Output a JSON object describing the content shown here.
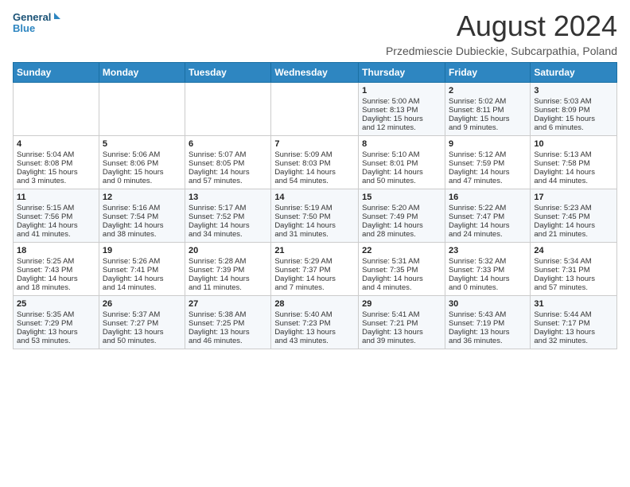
{
  "header": {
    "logo_line1": "General",
    "logo_line2": "Blue",
    "month_title": "August 2024",
    "location": "Przedmiescie Dubieckie, Subcarpathia, Poland"
  },
  "days_of_week": [
    "Sunday",
    "Monday",
    "Tuesday",
    "Wednesday",
    "Thursday",
    "Friday",
    "Saturday"
  ],
  "weeks": [
    [
      {
        "day": "",
        "text": ""
      },
      {
        "day": "",
        "text": ""
      },
      {
        "day": "",
        "text": ""
      },
      {
        "day": "",
        "text": ""
      },
      {
        "day": "1",
        "text": "Sunrise: 5:00 AM\nSunset: 8:13 PM\nDaylight: 15 hours\nand 12 minutes."
      },
      {
        "day": "2",
        "text": "Sunrise: 5:02 AM\nSunset: 8:11 PM\nDaylight: 15 hours\nand 9 minutes."
      },
      {
        "day": "3",
        "text": "Sunrise: 5:03 AM\nSunset: 8:09 PM\nDaylight: 15 hours\nand 6 minutes."
      }
    ],
    [
      {
        "day": "4",
        "text": "Sunrise: 5:04 AM\nSunset: 8:08 PM\nDaylight: 15 hours\nand 3 minutes."
      },
      {
        "day": "5",
        "text": "Sunrise: 5:06 AM\nSunset: 8:06 PM\nDaylight: 15 hours\nand 0 minutes."
      },
      {
        "day": "6",
        "text": "Sunrise: 5:07 AM\nSunset: 8:05 PM\nDaylight: 14 hours\nand 57 minutes."
      },
      {
        "day": "7",
        "text": "Sunrise: 5:09 AM\nSunset: 8:03 PM\nDaylight: 14 hours\nand 54 minutes."
      },
      {
        "day": "8",
        "text": "Sunrise: 5:10 AM\nSunset: 8:01 PM\nDaylight: 14 hours\nand 50 minutes."
      },
      {
        "day": "9",
        "text": "Sunrise: 5:12 AM\nSunset: 7:59 PM\nDaylight: 14 hours\nand 47 minutes."
      },
      {
        "day": "10",
        "text": "Sunrise: 5:13 AM\nSunset: 7:58 PM\nDaylight: 14 hours\nand 44 minutes."
      }
    ],
    [
      {
        "day": "11",
        "text": "Sunrise: 5:15 AM\nSunset: 7:56 PM\nDaylight: 14 hours\nand 41 minutes."
      },
      {
        "day": "12",
        "text": "Sunrise: 5:16 AM\nSunset: 7:54 PM\nDaylight: 14 hours\nand 38 minutes."
      },
      {
        "day": "13",
        "text": "Sunrise: 5:17 AM\nSunset: 7:52 PM\nDaylight: 14 hours\nand 34 minutes."
      },
      {
        "day": "14",
        "text": "Sunrise: 5:19 AM\nSunset: 7:50 PM\nDaylight: 14 hours\nand 31 minutes."
      },
      {
        "day": "15",
        "text": "Sunrise: 5:20 AM\nSunset: 7:49 PM\nDaylight: 14 hours\nand 28 minutes."
      },
      {
        "day": "16",
        "text": "Sunrise: 5:22 AM\nSunset: 7:47 PM\nDaylight: 14 hours\nand 24 minutes."
      },
      {
        "day": "17",
        "text": "Sunrise: 5:23 AM\nSunset: 7:45 PM\nDaylight: 14 hours\nand 21 minutes."
      }
    ],
    [
      {
        "day": "18",
        "text": "Sunrise: 5:25 AM\nSunset: 7:43 PM\nDaylight: 14 hours\nand 18 minutes."
      },
      {
        "day": "19",
        "text": "Sunrise: 5:26 AM\nSunset: 7:41 PM\nDaylight: 14 hours\nand 14 minutes."
      },
      {
        "day": "20",
        "text": "Sunrise: 5:28 AM\nSunset: 7:39 PM\nDaylight: 14 hours\nand 11 minutes."
      },
      {
        "day": "21",
        "text": "Sunrise: 5:29 AM\nSunset: 7:37 PM\nDaylight: 14 hours\nand 7 minutes."
      },
      {
        "day": "22",
        "text": "Sunrise: 5:31 AM\nSunset: 7:35 PM\nDaylight: 14 hours\nand 4 minutes."
      },
      {
        "day": "23",
        "text": "Sunrise: 5:32 AM\nSunset: 7:33 PM\nDaylight: 14 hours\nand 0 minutes."
      },
      {
        "day": "24",
        "text": "Sunrise: 5:34 AM\nSunset: 7:31 PM\nDaylight: 13 hours\nand 57 minutes."
      }
    ],
    [
      {
        "day": "25",
        "text": "Sunrise: 5:35 AM\nSunset: 7:29 PM\nDaylight: 13 hours\nand 53 minutes."
      },
      {
        "day": "26",
        "text": "Sunrise: 5:37 AM\nSunset: 7:27 PM\nDaylight: 13 hours\nand 50 minutes."
      },
      {
        "day": "27",
        "text": "Sunrise: 5:38 AM\nSunset: 7:25 PM\nDaylight: 13 hours\nand 46 minutes."
      },
      {
        "day": "28",
        "text": "Sunrise: 5:40 AM\nSunset: 7:23 PM\nDaylight: 13 hours\nand 43 minutes."
      },
      {
        "day": "29",
        "text": "Sunrise: 5:41 AM\nSunset: 7:21 PM\nDaylight: 13 hours\nand 39 minutes."
      },
      {
        "day": "30",
        "text": "Sunrise: 5:43 AM\nSunset: 7:19 PM\nDaylight: 13 hours\nand 36 minutes."
      },
      {
        "day": "31",
        "text": "Sunrise: 5:44 AM\nSunset: 7:17 PM\nDaylight: 13 hours\nand 32 minutes."
      }
    ]
  ]
}
